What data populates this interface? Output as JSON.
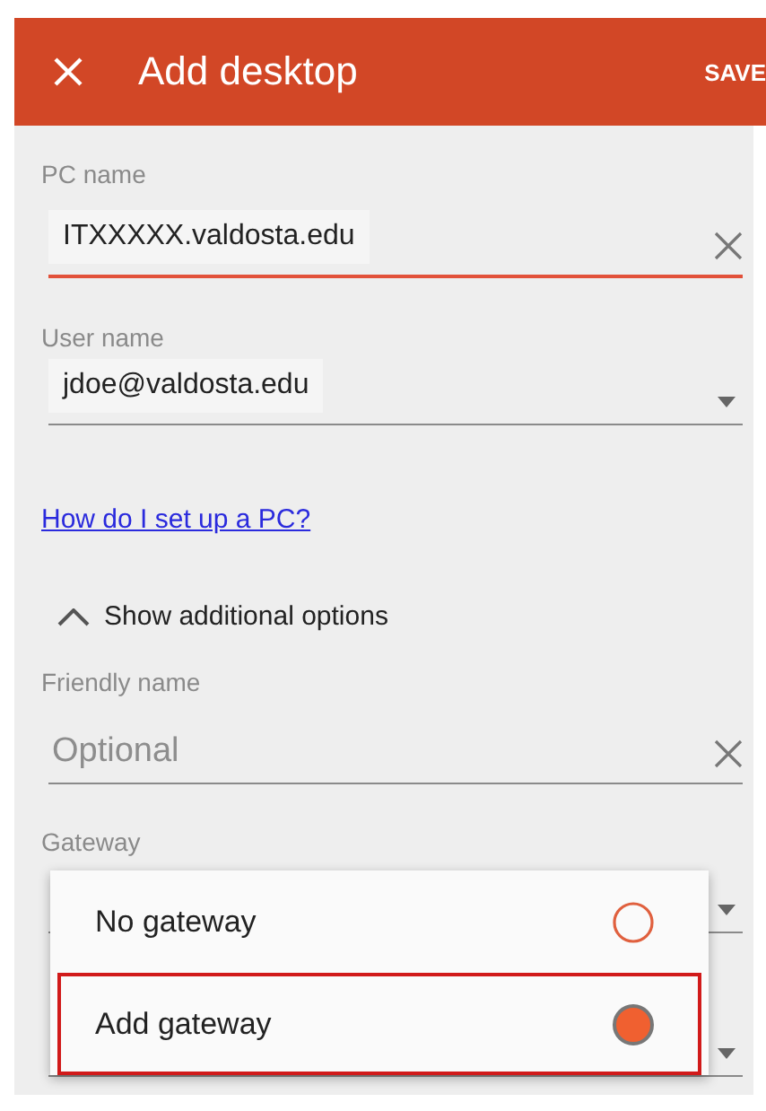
{
  "app_bar": {
    "title": "Add desktop",
    "action": "SAVE"
  },
  "fields": [
    {
      "kind": "text",
      "label": "PC name",
      "value": "ITXXXXX.valdosta.edu",
      "focused": true
    },
    {
      "kind": "dropdown",
      "label": "User name",
      "value": "jdoe@valdosta.edu",
      "focused": false
    }
  ],
  "help_link": "How do I set up a PC?",
  "options_toggle": {
    "label": "Show additional options",
    "expanded": true
  },
  "additional_fields": [
    {
      "kind": "text",
      "label": "Friendly name",
      "placeholder": "Optional",
      "focused": false
    },
    {
      "kind": "dropdown",
      "label": "Gateway",
      "focused": false
    },
    {
      "kind": "dropdown",
      "focused": false
    }
  ],
  "gateway_menu": {
    "items": [
      {
        "label": "No gateway",
        "selected": false,
        "outlined": false
      },
      {
        "label": "Add gateway",
        "selected": true,
        "outlined": true
      }
    ]
  }
}
